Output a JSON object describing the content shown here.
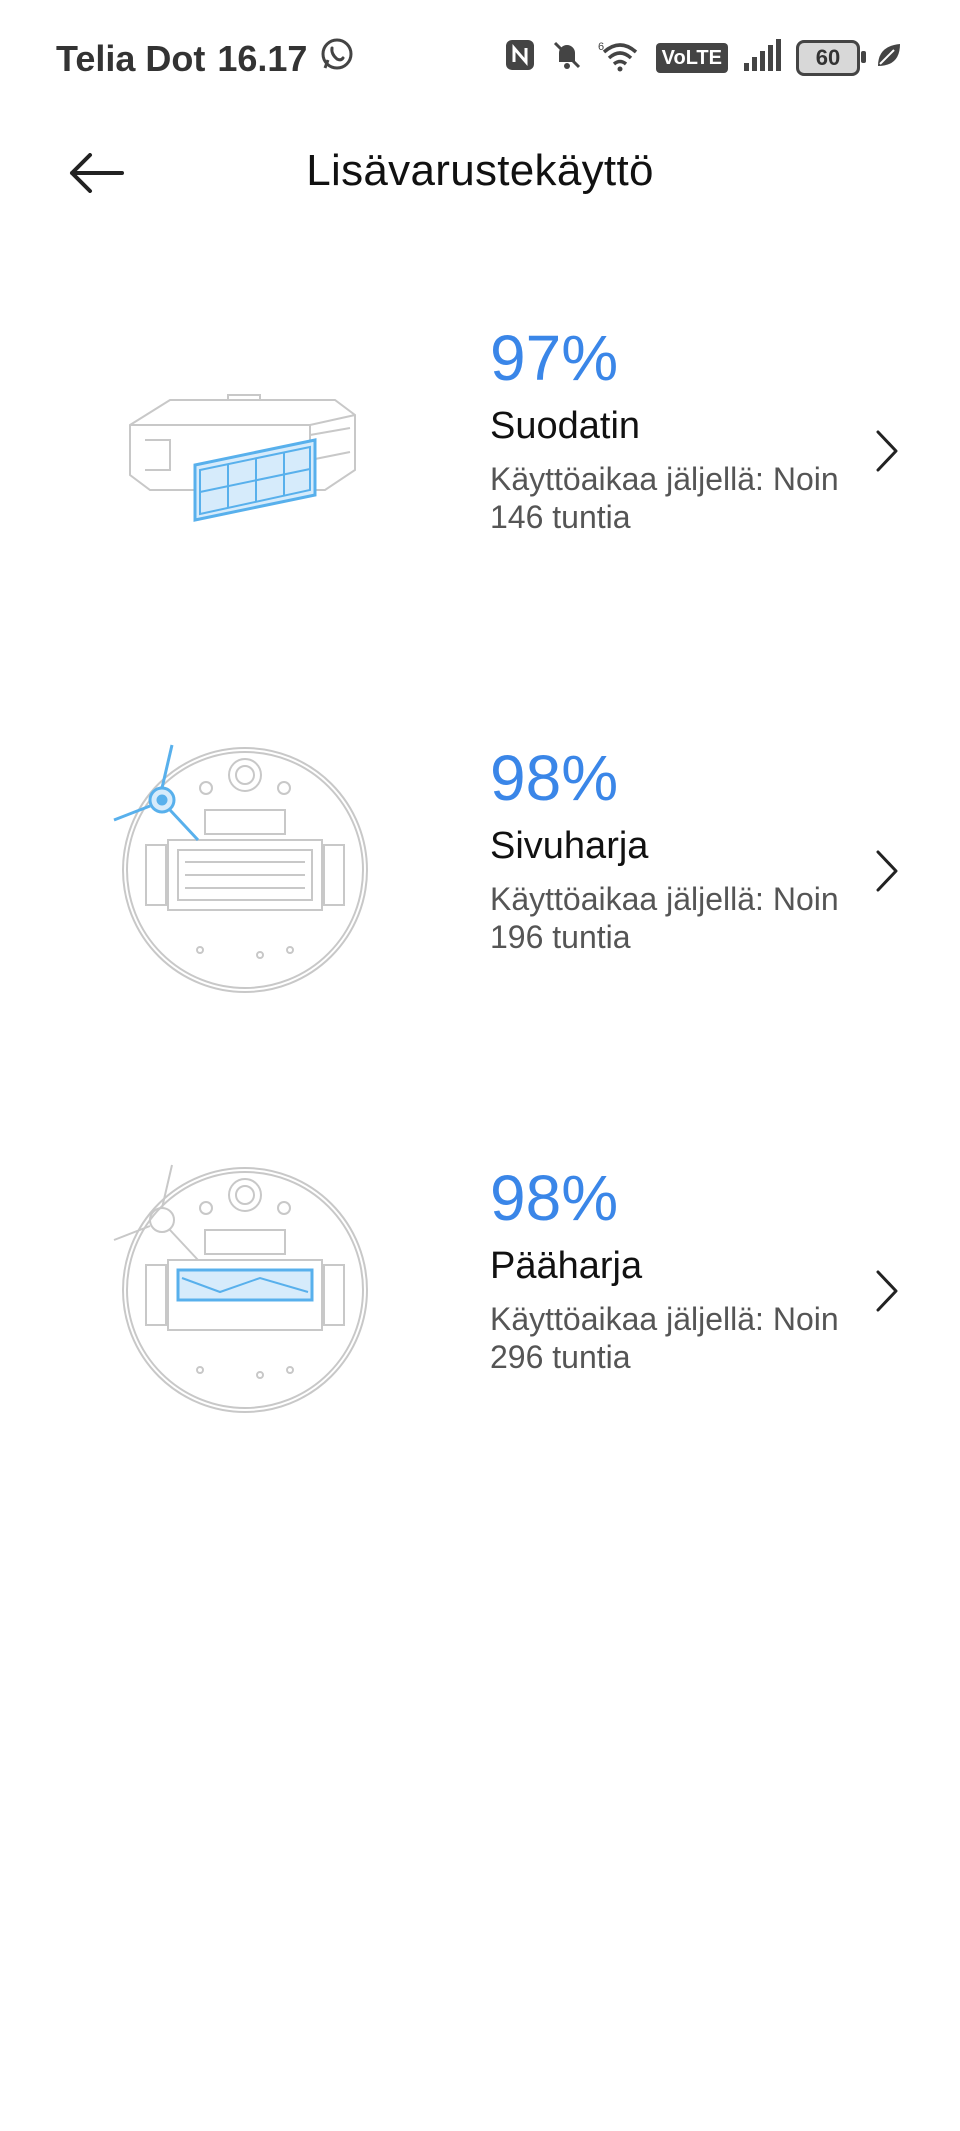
{
  "status_bar": {
    "carrier": "Telia Dot",
    "time": "16.17",
    "volte": "VoLTE",
    "battery": "60",
    "icons": [
      "whatsapp-icon",
      "nfc-icon",
      "bell-muted-icon",
      "wifi-icon",
      "signal-icon",
      "battery-icon",
      "leaf-icon"
    ]
  },
  "header": {
    "title": "Lisävarustekäyttö",
    "back_icon": "arrow-left-icon"
  },
  "accent_color": "#3a86e8",
  "accessories": [
    {
      "percent": "97%",
      "name": "Suodatin",
      "remaining_label": "Käyttöaikaa jäljellä: Noin",
      "remaining_value": "146 tuntia",
      "image": "filter-illustration"
    },
    {
      "percent": "98%",
      "name": "Sivuharja",
      "remaining_label": "Käyttöaikaa jäljellä: Noin",
      "remaining_value": "196 tuntia",
      "image": "side-brush-illustration"
    },
    {
      "percent": "98%",
      "name": "Pääharja",
      "remaining_label": "Käyttöaikaa jäljellä: Noin",
      "remaining_value": "296 tuntia",
      "image": "main-brush-illustration"
    }
  ]
}
